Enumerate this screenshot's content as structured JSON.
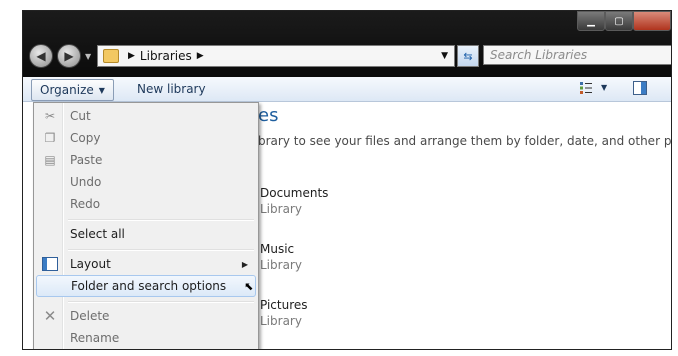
{
  "address": {
    "root": "Libraries"
  },
  "search": {
    "placeholder": "Search Libraries"
  },
  "toolbar": {
    "organize": "Organize",
    "new_library": "New library"
  },
  "content": {
    "heading": "es",
    "subtitle": "brary to see your files and arrange them by folder, date, and other properties.",
    "libraries": [
      {
        "name": "Documents",
        "type": "Library"
      },
      {
        "name": "Music",
        "type": "Library"
      },
      {
        "name": "Pictures",
        "type": "Library"
      }
    ]
  },
  "menu": {
    "items": [
      {
        "label": "Cut",
        "icon": "scissors-icon"
      },
      {
        "label": "Copy",
        "icon": "copy-icon"
      },
      {
        "label": "Paste",
        "icon": "paste-icon"
      },
      {
        "label": "Undo"
      },
      {
        "label": "Redo"
      },
      {
        "label": "Select all"
      },
      {
        "label": "Layout",
        "icon": "layout-icon"
      },
      {
        "label": "Folder and search options"
      },
      {
        "label": "Delete",
        "icon": "delete-icon"
      },
      {
        "label": "Rename"
      }
    ]
  },
  "colors": {
    "title_text": "#1e5e9e",
    "menu_hover": "#dce9f8",
    "toolbar_text": "#1e395b"
  }
}
